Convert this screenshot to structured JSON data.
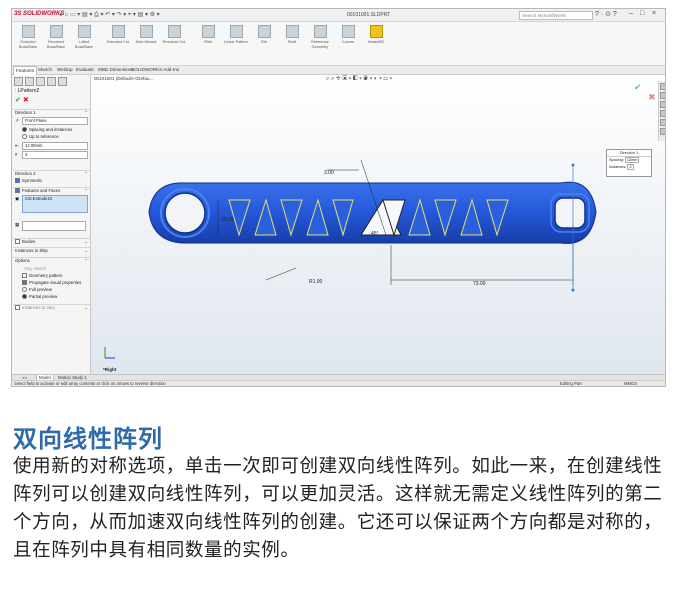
{
  "app": {
    "logo": "3S SOLIDWORKS",
    "doc_title": "00101001.SLDPRT",
    "search_placeholder": "Search MySolidWorks"
  },
  "ribbon": {
    "buttons": [
      "Extruded Boss/Base",
      "Revolved Boss/Base",
      "Lofted Boss/Base",
      "Boundary Boss/Base",
      "Extruded Cut",
      "Hole Wizard",
      "Revolved Cut",
      "Lofted Cut",
      "Boundary Cut",
      "Fillet",
      "Linear Pattern",
      "Rib",
      "Draft",
      "Shell",
      "Wrap",
      "Intersect",
      "Mirror",
      "Reference Geometry",
      "Curves",
      "Instant3D"
    ]
  },
  "command_tabs": [
    "Features",
    "Sketch",
    "Weldup",
    "Evaluate",
    "MBD Dimensions",
    "SOLIDWORKS Add-Ins"
  ],
  "property_manager": {
    "title": "LPattern2",
    "direction1": {
      "header": "Direction 1",
      "reference": "Front Plane",
      "option_spacing": "Spacing and instances",
      "option_up_to": "Up to reference",
      "spacing": "12.00mm",
      "instances": "3"
    },
    "direction2": {
      "header": "Direction 2",
      "symmetric": "Symmetric"
    },
    "features_faces": {
      "header": "Features and Faces",
      "item": "Cut-Extrude10"
    },
    "bodies": "Bodies",
    "instances_to_skip": "Instances to Skip",
    "options": {
      "header": "Options",
      "vary_sketch": "Vary sketch",
      "geometry_pattern": "Geometry pattern",
      "propagate": "Propagate visual properties",
      "full_preview": "Full preview",
      "partial_preview": "Partial preview"
    },
    "instances_to_vary": "Instances to Vary"
  },
  "viewport": {
    "breadcrumb": "00101001 (Default<<Defau...",
    "dimensions": {
      "top": "3.00",
      "height": "20.00",
      "angle": "45°",
      "radius": "R1.00",
      "length": "73.00"
    },
    "callout": {
      "title": "Direction 1",
      "spacing_label": "Spacing:",
      "spacing_value": "12mm",
      "instances_label": "Instances:",
      "instances_value": "3"
    },
    "view_label": "*Right"
  },
  "bottom_tabs": [
    "Model",
    "Motion Study 1"
  ],
  "status": {
    "hint": "Select field to activate or edit array contents or click on arrows to reverse direction",
    "mode": "Editing Part",
    "units": "MMGS"
  },
  "article": {
    "heading": "双向线性阵列",
    "body": "使用新的对称选项，单击一次即可创建双向线性阵列。如此一来，在创建线性阵列可以创建双向线性阵列，可以更加灵活。这样就无需定义线性阵列的第二个方向，从而加速双向线性阵列的创建。它还可以保证两个方向都是对称的，且在阵列中具有相同数量的实例。"
  },
  "colors": {
    "part": "#2457d8",
    "heading": "#2f6aa8",
    "preview": "#e8e06a"
  }
}
